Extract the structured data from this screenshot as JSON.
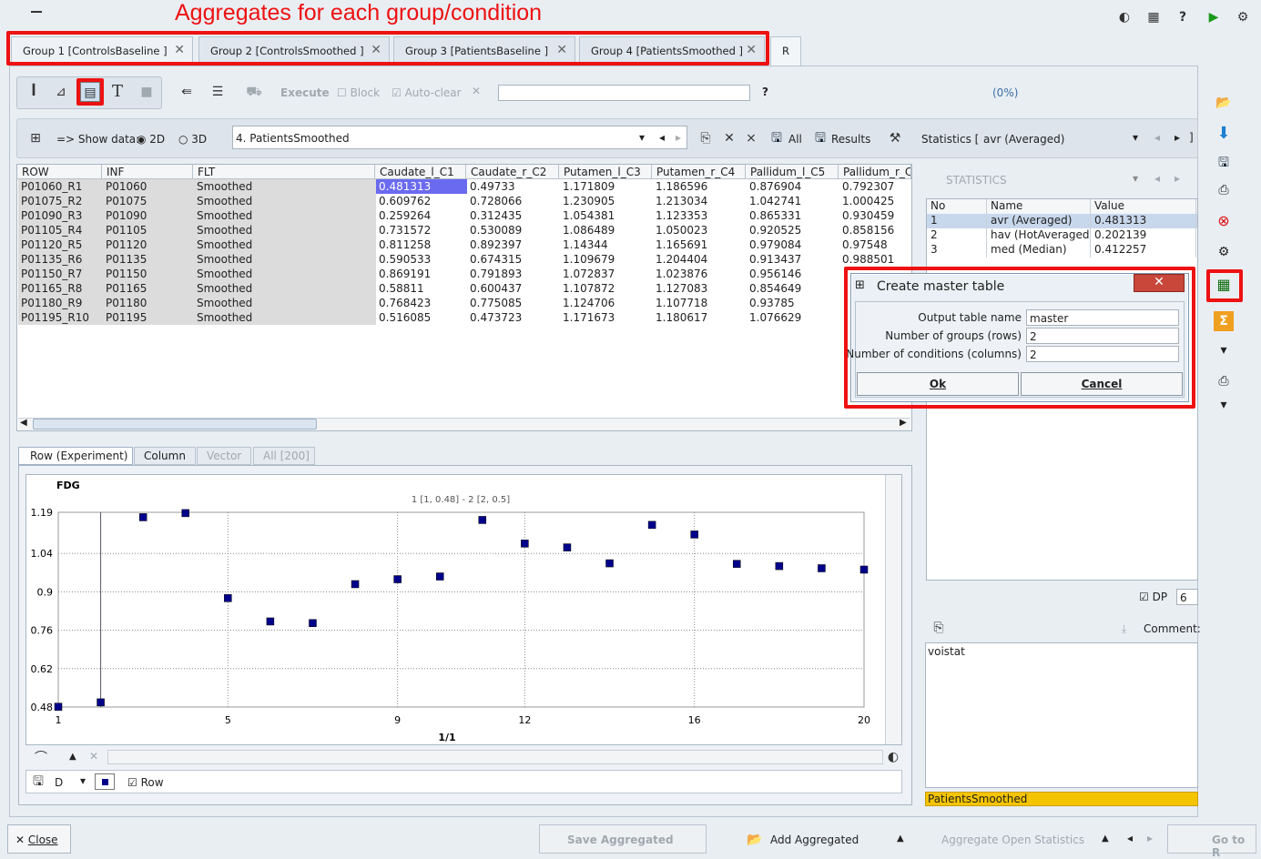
{
  "annotation": {
    "title": "Aggregates for each group/condition"
  },
  "tabs": [
    {
      "label": "Group 1 [ControlsBaseline ]"
    },
    {
      "label": "Group 2 [ControlsSmoothed ]"
    },
    {
      "label": "Group 3 [PatientsBaseline ]"
    },
    {
      "label": "Group 4 [PatientsSmoothed ]"
    },
    {
      "label": "R"
    }
  ],
  "toolbar": {
    "execute": "Execute",
    "block": "Block",
    "autoclear": "Auto-clear",
    "help": "?",
    "progress": "(0%)"
  },
  "datarow": {
    "show_data": "=> Show data:",
    "opt2d": "2D",
    "opt3d": "3D",
    "dataset": "4. PatientsSmoothed",
    "all": "All",
    "results": "Results",
    "statistics_label": "Statistics [",
    "statistics_value": "avr (Averaged)"
  },
  "grid": {
    "columns": [
      "ROW",
      "INF",
      "FLT",
      "Caudate_l_C1",
      "Caudate_r_C2",
      "Putamen_l_C3",
      "Putamen_r_C4",
      "Pallidum_l_C5",
      "Pallidum_r_C"
    ],
    "rows": [
      [
        "P01060_R1",
        "P01060",
        "Smoothed",
        "0.481313",
        "0.49733",
        "1.171809",
        "1.186596",
        "0.876904",
        "0.792307"
      ],
      [
        "P01075_R2",
        "P01075",
        "Smoothed",
        "0.609762",
        "0.728066",
        "1.230905",
        "1.213034",
        "1.042741",
        "1.000425"
      ],
      [
        "P01090_R3",
        "P01090",
        "Smoothed",
        "0.259264",
        "0.312435",
        "1.054381",
        "1.123353",
        "0.865331",
        "0.930459"
      ],
      [
        "P01105_R4",
        "P01105",
        "Smoothed",
        "0.731572",
        "0.530089",
        "1.086489",
        "1.050023",
        "0.920525",
        "0.858156"
      ],
      [
        "P01120_R5",
        "P01120",
        "Smoothed",
        "0.811258",
        "0.892397",
        "1.14344",
        "1.165691",
        "0.979084",
        "0.97548"
      ],
      [
        "P01135_R6",
        "P01135",
        "Smoothed",
        "0.590533",
        "0.674315",
        "1.109679",
        "1.204404",
        "0.913437",
        "0.988501"
      ],
      [
        "P01150_R7",
        "P01150",
        "Smoothed",
        "0.869191",
        "0.791893",
        "1.072837",
        "1.023876",
        "0.956146",
        ""
      ],
      [
        "P01165_R8",
        "P01165",
        "Smoothed",
        "0.58811",
        "0.600437",
        "1.107872",
        "1.127083",
        "0.854649",
        ""
      ],
      [
        "P01180_R9",
        "P01180",
        "Smoothed",
        "0.768423",
        "0.775085",
        "1.124706",
        "1.107718",
        "0.93785",
        ""
      ],
      [
        "P01195_R10",
        "P01195",
        "Smoothed",
        "0.516085",
        "0.473723",
        "1.171673",
        "1.180617",
        "1.076629",
        ""
      ]
    ]
  },
  "subtabs": [
    "Row (Experiment)",
    "Column",
    "Vector",
    "All [200]"
  ],
  "chart_data": {
    "type": "scatter",
    "title": "FDG",
    "subtitle": "1 [1, 0.48] - 2 [2, 0.5]",
    "xlabel": "1/1",
    "ylabel": "",
    "xticks": [
      "1",
      "5",
      "9",
      "12",
      "16",
      "20"
    ],
    "yticks": [
      "1.19",
      "1.04",
      "0.9",
      "0.76",
      "0.62",
      "0.48"
    ],
    "xlim": [
      1,
      20
    ],
    "ylim": [
      0.48,
      1.19
    ],
    "x": [
      1,
      2,
      3,
      4,
      5,
      6,
      7,
      8,
      9,
      10,
      11,
      12,
      13,
      14,
      15,
      16,
      17,
      18,
      19,
      20
    ],
    "y": [
      0.481,
      0.497,
      1.172,
      1.187,
      0.877,
      0.792,
      0.786,
      0.928,
      0.946,
      0.956,
      1.162,
      1.076,
      1.062,
      1.004,
      1.144,
      1.109,
      1.002,
      0.994,
      0.986,
      0.981
    ],
    "marker_color": "#00008b"
  },
  "chart_footer": {
    "d": "D",
    "row": "Row"
  },
  "statistics": {
    "header": "STATISTICS",
    "columns": [
      "No",
      "Name",
      "Value"
    ],
    "rows": [
      [
        "1",
        "avr (Averaged)",
        "0.481313"
      ],
      [
        "2",
        "hav (HotAveraged)",
        "0.202139"
      ],
      [
        "3",
        "med (Median)",
        "0.412257"
      ]
    ],
    "dp_label": "DP",
    "dp_value": "6",
    "comment_label": "Comment:",
    "comment_text": "voistat",
    "status": "PatientsSmoothed"
  },
  "dialog": {
    "title": "Create master table",
    "fields": [
      {
        "label": "Output table name",
        "value": "master"
      },
      {
        "label": "Number of groups (rows)",
        "value": "2"
      },
      {
        "label": "Number of conditions (columns)",
        "value": "2"
      }
    ],
    "ok": "Ok",
    "cancel": "Cancel"
  },
  "bottom": {
    "close": "Close",
    "save": "Save Aggregated",
    "add": "Add Aggregated",
    "open": "Aggregate Open Statistics",
    "goto": "Go to R"
  },
  "colors": {
    "highlight": "#e11111",
    "selection": "#6a6af0",
    "status": "#f5c400"
  }
}
